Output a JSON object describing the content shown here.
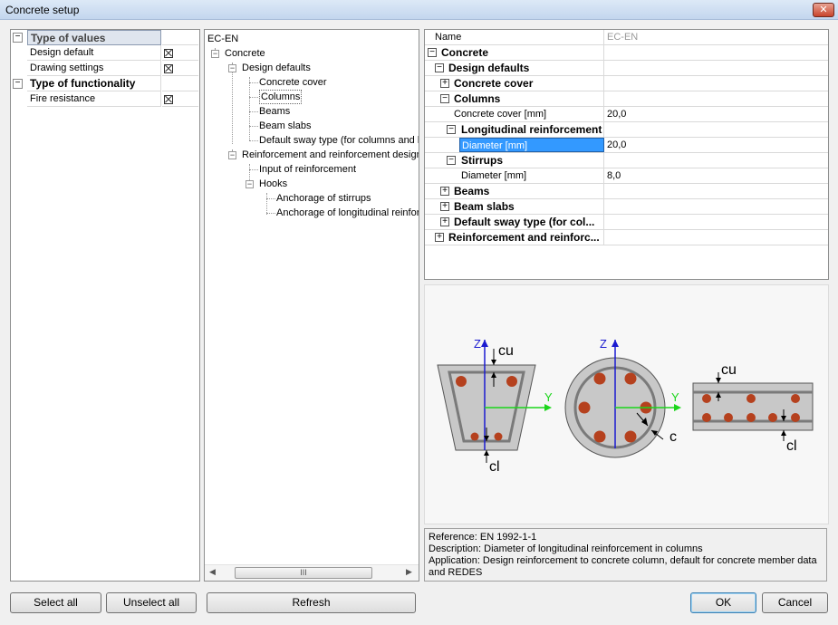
{
  "window": {
    "title": "Concrete setup",
    "close_glyph": "✕"
  },
  "left_panel": {
    "rows": [
      {
        "label": "Type of values",
        "header": true,
        "toggle": "⊟"
      },
      {
        "label": "Design default",
        "checked": true
      },
      {
        "label": "Drawing settings",
        "checked": true
      },
      {
        "label": "Type of functionality",
        "header": true,
        "toggle": "⊟"
      },
      {
        "label": "Fire resistance",
        "checked": true
      }
    ]
  },
  "tree": {
    "root": "EC-EN",
    "nodes": {
      "concrete": "Concrete",
      "design_defaults": "Design defaults",
      "concrete_cover": "Concrete cover",
      "columns": "Columns",
      "beams": "Beams",
      "beam_slabs": "Beam slabs",
      "default_sway": "Default sway type (for columns and be",
      "reinf": "Reinforcement and reinforcement design",
      "input_reinf": "Input of reinforcement",
      "hooks": "Hooks",
      "anch_stirrups": "Anchorage of stirrups",
      "anch_long": "Anchorage of longitudinal reinforc"
    },
    "scroll_grip": "III"
  },
  "properties": {
    "header_name": "Name",
    "header_value": "EC-EN",
    "rows": {
      "concrete": "Concrete",
      "design_defaults": "Design defaults",
      "concrete_cover": "Concrete cover",
      "columns": "Columns",
      "col_cover_label": "Concrete cover [mm]",
      "col_cover_value": "20,0",
      "long_reinf": "Longitudinal reinforcement",
      "diameter_label": "Diameter [mm]",
      "diameter_value": "20,0",
      "stirrups": "Stirrups",
      "stirrup_diameter_label": "Diameter [mm]",
      "stirrup_diameter_value": "8,0",
      "beams": "Beams",
      "beam_slabs": "Beam slabs",
      "default_sway": "Default sway type (for col...",
      "reinf": "Reinforcement and reinforc..."
    }
  },
  "diagram": {
    "z": "Z",
    "y": "Y",
    "cu": "cu",
    "cl": "cl",
    "c": "c"
  },
  "info": {
    "reference": "Reference:  EN 1992-1-1",
    "description": "Description:  Diameter of longitudinal reinforcement in columns",
    "application": "Application:  Design reinforcement to concrete column, default for concrete member data",
    "application_cont": "and REDES"
  },
  "buttons": {
    "select_all": "Select all",
    "unselect_all": "Unselect all",
    "refresh": "Refresh",
    "ok": "OK",
    "cancel": "Cancel"
  },
  "colors": {
    "selection": "#3399ff",
    "rebar": "#b5411e",
    "axis_z": "#1a1ad0",
    "axis_y": "#1bd61b"
  }
}
